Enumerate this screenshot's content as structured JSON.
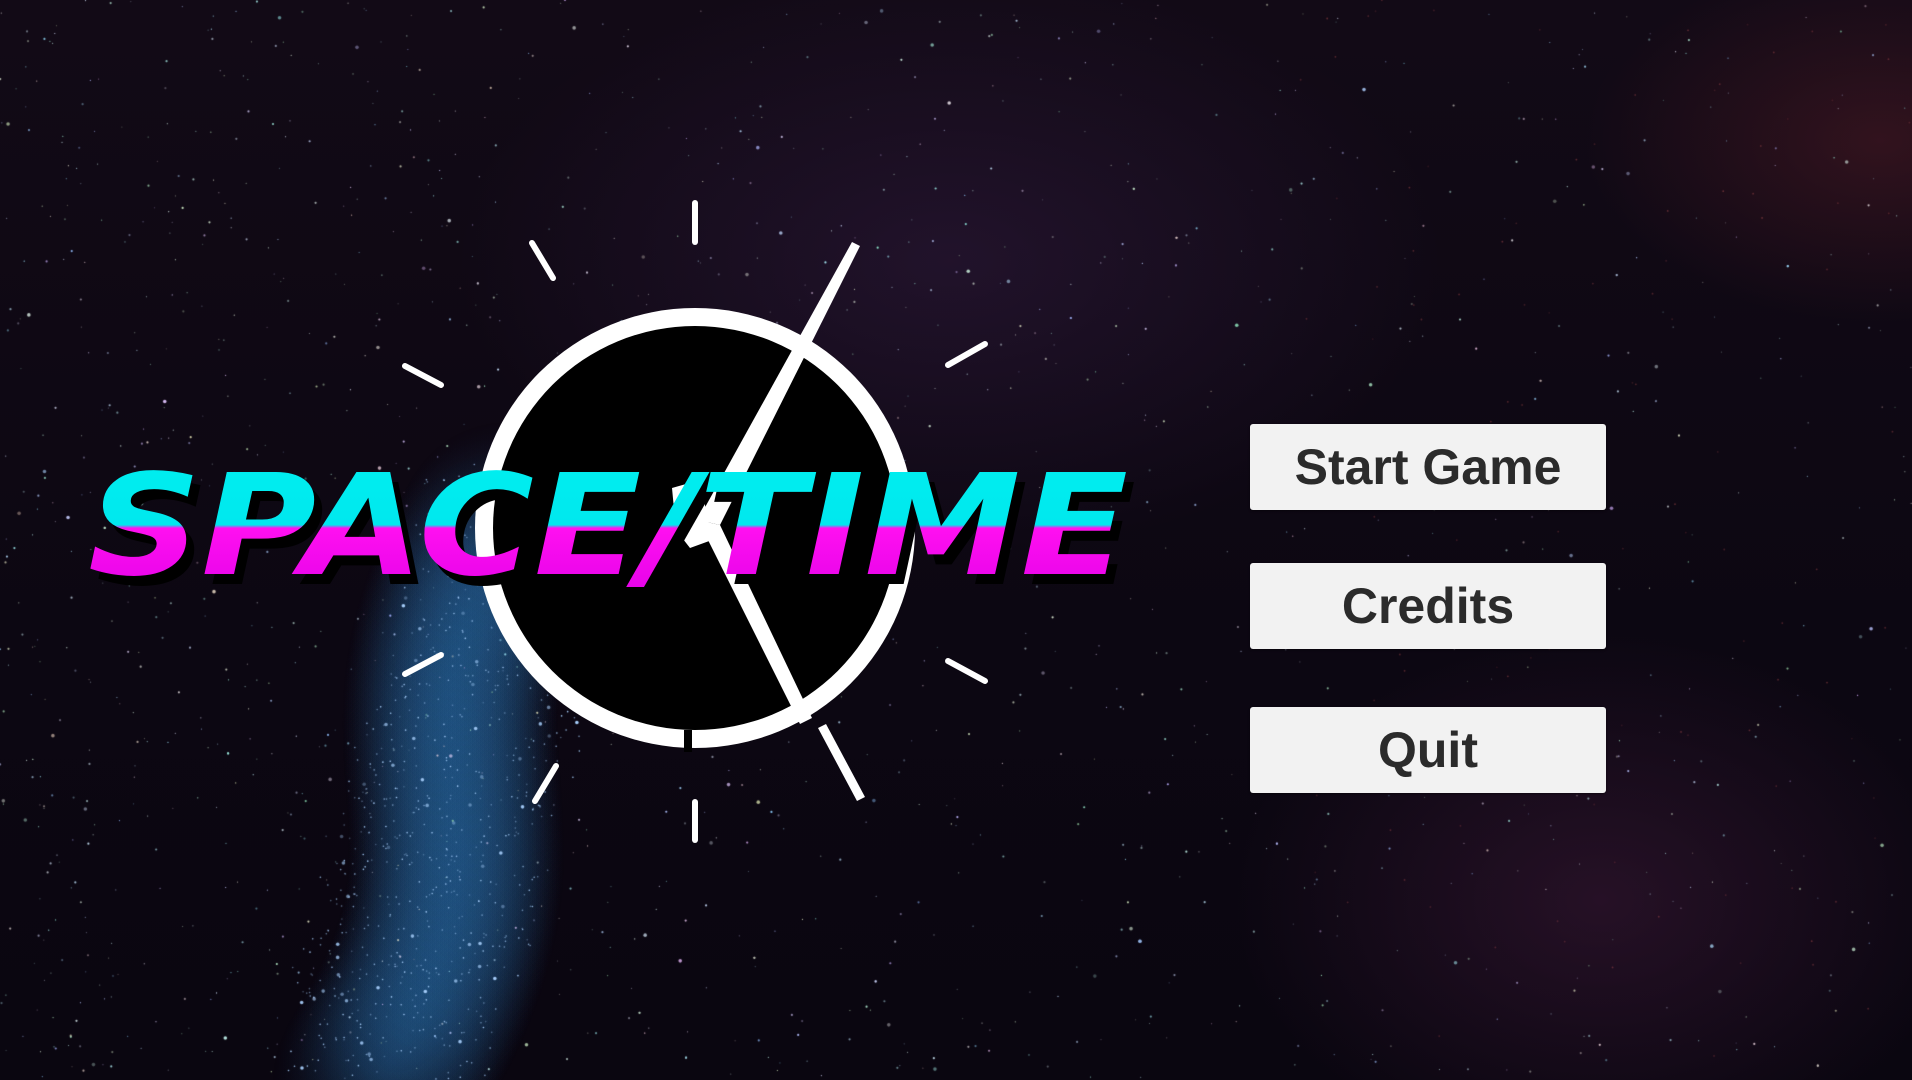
{
  "game": {
    "title": "SPACE/TIME"
  },
  "menu": {
    "start_label": "Start Game",
    "credits_label": "Credits",
    "quit_label": "Quit"
  },
  "colors": {
    "title_top": "#00f0f0",
    "title_bottom": "#ff10f0",
    "button_bg": "#f2f2f2",
    "button_text": "#2b2b2b",
    "clock_line": "#ffffff",
    "clock_face": "#000000"
  },
  "icons": {
    "logo_clock": "clock-icon",
    "clock_hand": "clock-hand-icon"
  }
}
